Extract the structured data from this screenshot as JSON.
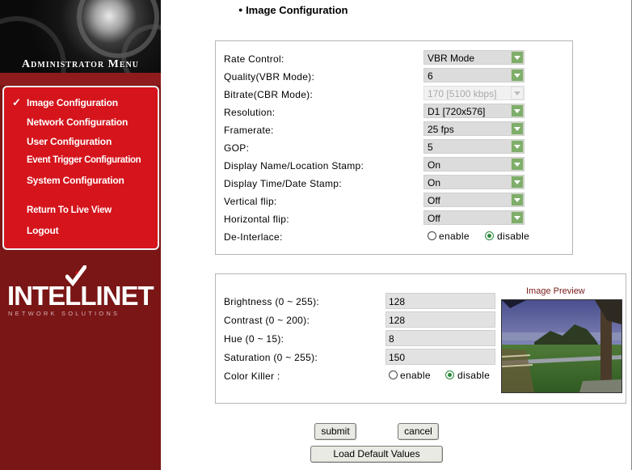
{
  "sidebar": {
    "title": "Administrator Menu",
    "items": [
      {
        "label": "Image Configuration",
        "active": true
      },
      {
        "label": "Network Configuration"
      },
      {
        "label": "User Configuration"
      },
      {
        "label": "Event Trigger Configuration"
      },
      {
        "label": "System Configuration"
      },
      {
        "label": "Return To Live View"
      },
      {
        "label": "Logout"
      }
    ],
    "logo": {
      "name": "INTELLINET",
      "sub": "NETWORK SOLUTIONS"
    }
  },
  "page": {
    "title": "Image Configuration",
    "bullet": "●"
  },
  "video": {
    "rate_control": {
      "label": "Rate Control:",
      "value": "VBR Mode"
    },
    "quality": {
      "label": "Quality(VBR Mode):",
      "value": "6"
    },
    "bitrate": {
      "label": "Bitrate(CBR Mode):",
      "value": "170 [5100 kbps]",
      "disabled": true
    },
    "resolution": {
      "label": "Resolution:",
      "value": "D1 [720x576]"
    },
    "framerate": {
      "label": "Framerate:",
      "value": "25 fps"
    },
    "gop": {
      "label": "GOP:",
      "value": "5"
    },
    "name_stamp": {
      "label": "Display Name/Location Stamp:",
      "value": "On"
    },
    "time_stamp": {
      "label": "Display Time/Date Stamp:",
      "value": "On"
    },
    "vflip": {
      "label": "Vertical flip:",
      "value": "Off"
    },
    "hflip": {
      "label": "Horizontal flip:",
      "value": "Off"
    },
    "deinterlace": {
      "label": "De-Interlace:",
      "options": [
        "enable",
        "disable"
      ],
      "selected": "disable"
    }
  },
  "image": {
    "brightness": {
      "label": "Brightness (0 ~ 255):",
      "value": "128"
    },
    "contrast": {
      "label": "Contrast (0 ~ 200):",
      "value": "128"
    },
    "hue": {
      "label": "Hue (0 ~ 15):",
      "value": "8"
    },
    "saturation": {
      "label": "Saturation (0 ~ 255):",
      "value": "150"
    },
    "color_killer": {
      "label": "Color Killer :",
      "options": [
        "enable",
        "disable"
      ],
      "selected": "disable"
    },
    "preview_title": "Image Preview"
  },
  "buttons": {
    "submit": "submit",
    "cancel": "cancel",
    "load_default": "Load Default Values"
  },
  "colors": {
    "sidebar_bg": "#7a1616",
    "menu_box": "#d5141c",
    "dropdown_arrow": "#7fae6a"
  }
}
